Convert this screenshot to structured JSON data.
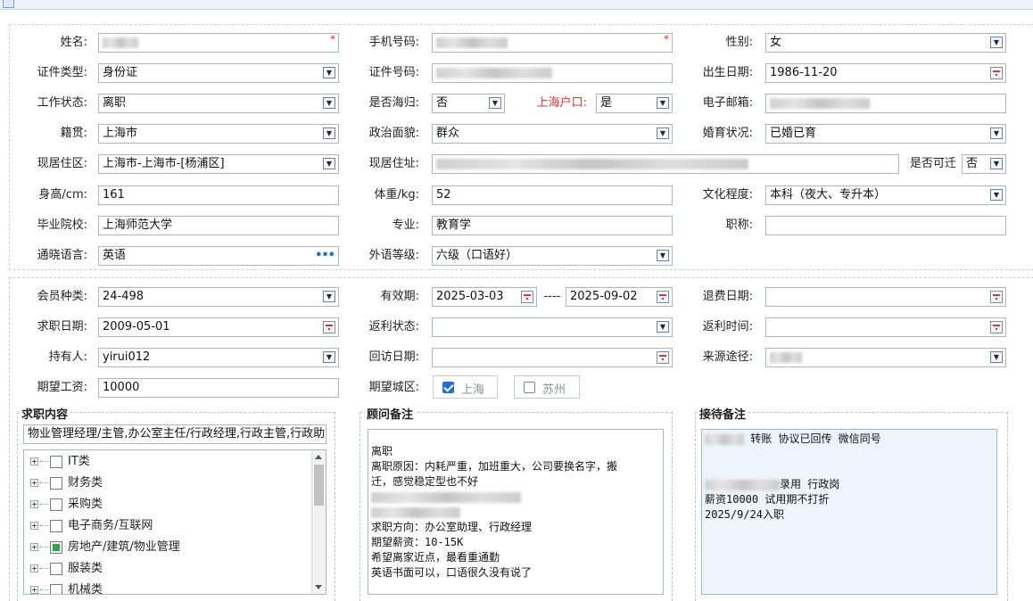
{
  "window": {
    "icon": "form-icon"
  },
  "basic": {
    "name": {
      "label": "姓名:",
      "value_redacted": true,
      "required": "*"
    },
    "mobile": {
      "label": "手机号码:",
      "required": "*"
    },
    "gender": {
      "label": "性别:",
      "value": "女"
    },
    "id_type": {
      "label": "证件类型:",
      "value": "身份证"
    },
    "id_number": {
      "label": "证件号码:"
    },
    "birth_date": {
      "label": "出生日期:",
      "value": "1986-11-20"
    },
    "work_status": {
      "label": "工作状态:",
      "value": "离职"
    },
    "overseas": {
      "label": "是否海归:",
      "value": "否"
    },
    "shanghai_hukou": {
      "label": "上海户口:",
      "value": "是"
    },
    "email": {
      "label": "电子邮箱:"
    },
    "native_place": {
      "label": "籍贯:",
      "value": "上海市"
    },
    "political": {
      "label": "政治面貌:",
      "value": "群众"
    },
    "marital": {
      "label": "婚育状况:",
      "value": "已婚已育"
    },
    "residence_area": {
      "label": "现居住区:",
      "value": "上海市-上海市-[杨浦区]"
    },
    "residence_address": {
      "label": "现居住址:"
    },
    "relocatable": {
      "label": "是否可迁",
      "value": "否"
    },
    "height": {
      "label": "身高/cm:",
      "value": "161"
    },
    "weight": {
      "label": "体重/kg:",
      "value": "52"
    },
    "education": {
      "label": "文化程度:",
      "value": "本科（夜大、专升本）"
    },
    "school": {
      "label": "毕业院校:",
      "value": "上海师范大学"
    },
    "major": {
      "label": "专业:",
      "value": "教育学"
    },
    "title": {
      "label": "职称:",
      "value": ""
    },
    "language": {
      "label": "通晓语言:",
      "value": "英语",
      "more": "•••"
    },
    "language_level": {
      "label": "外语等级:",
      "value": "六级（口语好）"
    }
  },
  "member": {
    "member_type": {
      "label": "会员种类:",
      "value": "24-498"
    },
    "valid_period": {
      "label": "有效期:",
      "start": "2025-03-03",
      "sep": "----",
      "end": "2025-09-02"
    },
    "refund_date": {
      "label": "退费日期:",
      "value": ""
    },
    "job_date": {
      "label": "求职日期:",
      "value": "2009-05-01"
    },
    "rebate_status": {
      "label": "返利状态:",
      "value": ""
    },
    "rebate_time": {
      "label": "返利时间:",
      "value": ""
    },
    "holder": {
      "label": "持有人:",
      "value": "yirui012"
    },
    "visit_date": {
      "label": "回访日期:",
      "value": ""
    },
    "source": {
      "label": "来源途径:"
    },
    "expected_salary": {
      "label": "期望工资:",
      "value": "10000"
    },
    "expected_city": {
      "label": "期望城区:",
      "options": [
        {
          "label": "上海",
          "checked": true
        },
        {
          "label": "苏州",
          "checked": false
        }
      ]
    }
  },
  "job_content": {
    "legend": "求职内容",
    "summary": "物业管理经理/主管,办公室主任/行政经理,行政主管,行政助",
    "tree": [
      {
        "label": "IT类",
        "checked": false
      },
      {
        "label": "财务类",
        "checked": false
      },
      {
        "label": "采购类",
        "checked": false
      },
      {
        "label": "电子商务/互联网",
        "checked": false
      },
      {
        "label": "房地产/建筑/物业管理",
        "checked": true
      },
      {
        "label": "服装类",
        "checked": false
      },
      {
        "label": "机械类",
        "checked": false
      }
    ]
  },
  "advisor_notes": {
    "legend": "顾问备注",
    "lines": [
      "离职",
      "离职原因：内耗严重，加班重大，公司要换名字，搬",
      "迁，感觉稳定型也不好",
      "求职方向：办公室助理、行政经理",
      "期望薪资：10-15K",
      "希望离家近点，最看重通勤",
      "英语书面可以，口语很久没有说了"
    ]
  },
  "reception_notes": {
    "legend": "接待备注",
    "line1_suffix": "转账 协议已回传   微信同号",
    "line2_suffix": "录用 行政岗",
    "line3": "薪资10000 试用期不打折",
    "line4": "2025/9/24入职"
  }
}
